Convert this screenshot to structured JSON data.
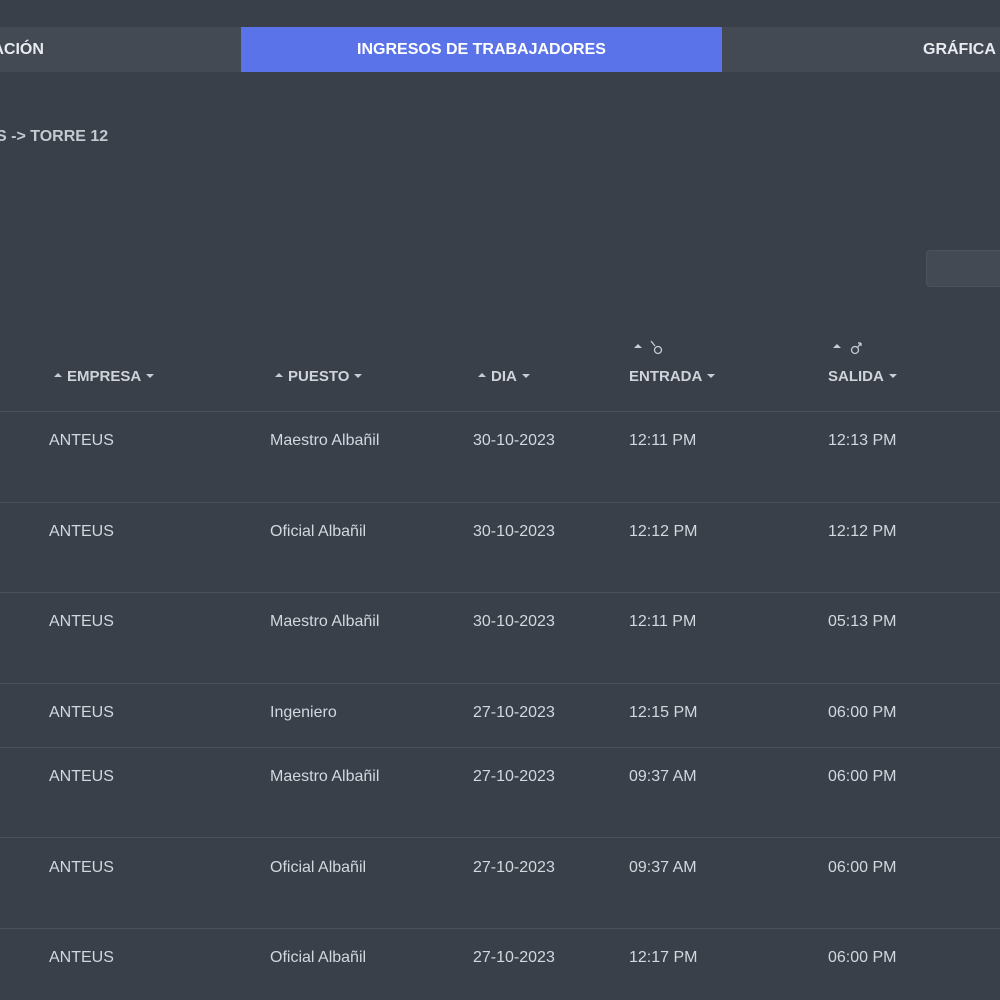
{
  "tabs": [
    {
      "label": "MACIÓN"
    },
    {
      "label": "INGRESOS DE TRABAJADORES"
    },
    {
      "label": "GRÁFICA"
    }
  ],
  "breadcrumb": "S -> TORRE 12",
  "table": {
    "headers": {
      "empresa": "EMPRESA",
      "puesto": "PUESTO",
      "dia": "DIA",
      "entrada": "ENTRADA",
      "salida": "SALIDA"
    },
    "rows": [
      {
        "empresa": "ANTEUS",
        "puesto": "Maestro Albañil",
        "dia": "30-10-2023",
        "entrada": "12:11 PM",
        "salida": "12:13 PM"
      },
      {
        "empresa": "ANTEUS",
        "puesto": "Oficial Albañil",
        "dia": "30-10-2023",
        "entrada": "12:12 PM",
        "salida": "12:12 PM"
      },
      {
        "empresa": "ANTEUS",
        "puesto": "Maestro Albañil",
        "dia": "30-10-2023",
        "entrada": "12:11 PM",
        "salida": "05:13 PM"
      },
      {
        "empresa": "ANTEUS",
        "puesto": "Ingeniero",
        "dia": "27-10-2023",
        "entrada": "12:15 PM",
        "salida": "06:00 PM"
      },
      {
        "empresa": "ANTEUS",
        "puesto": "Maestro Albañil",
        "dia": "27-10-2023",
        "entrada": "09:37 AM",
        "salida": "06:00 PM"
      },
      {
        "empresa": "ANTEUS",
        "puesto": "Oficial Albañil",
        "dia": "27-10-2023",
        "entrada": "09:37 AM",
        "salida": "06:00 PM"
      },
      {
        "empresa": "ANTEUS",
        "puesto": "Oficial Albañil",
        "dia": "27-10-2023",
        "entrada": "12:17 PM",
        "salida": "06:00 PM"
      }
    ]
  },
  "icons": {
    "entrada": "female-symbol-icon",
    "salida": "male-symbol-icon"
  },
  "colors": {
    "active_tab": "#5b73e8",
    "background": "#394049",
    "tabbar": "#434a54"
  }
}
